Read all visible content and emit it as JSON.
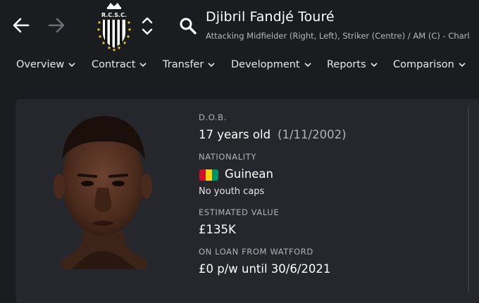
{
  "header": {
    "player_name": "Djibril Fandjé Touré",
    "roles": "Attacking Midfielder (Right, Left), Striker (Centre) / AM (C) - Charl",
    "club_crest_text": "R.C.S.C."
  },
  "tabs": [
    {
      "label": "Overview"
    },
    {
      "label": "Contract"
    },
    {
      "label": "Transfer"
    },
    {
      "label": "Development"
    },
    {
      "label": "Reports"
    },
    {
      "label": "Comparison"
    }
  ],
  "profile": {
    "dob_label": "D.O.B.",
    "age": "17 years old",
    "dob": "(1/11/2002)",
    "nationality_label": "NATIONALITY",
    "nationality": "Guinean",
    "youth_caps": "No youth caps",
    "value_label": "ESTIMATED VALUE",
    "value": "£135K",
    "loan_label": "ON LOAN FROM WATFORD",
    "loan_wage": "£0 p/w until 30/6/2021"
  },
  "colors": {
    "background": "#1b1c20",
    "panel": "#26272c",
    "flag_red": "#ce1126",
    "flag_yellow": "#fcd116",
    "flag_green": "#009460"
  },
  "icons": {
    "back": "arrow-left-icon",
    "forward": "arrow-right-icon",
    "switch": "chevron-up-down-icon",
    "search": "search-icon",
    "dropdown": "chevron-down-icon"
  }
}
